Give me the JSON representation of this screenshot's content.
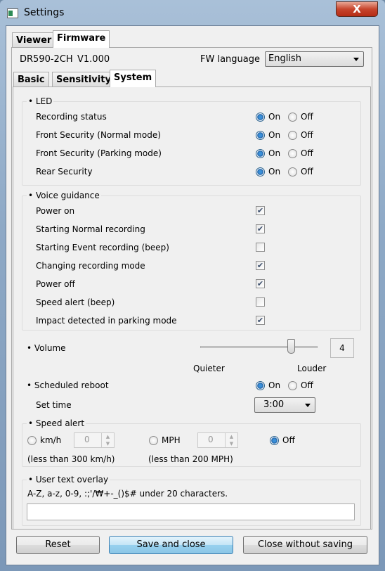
{
  "window": {
    "title": "Settings",
    "close": "X"
  },
  "tabs": [
    {
      "label": "Viewer"
    },
    {
      "label": "Firmware"
    }
  ],
  "model": "DR590-2CH",
  "version": "V1.000",
  "fw_language": {
    "label": "FW language",
    "value": "English"
  },
  "subtabs": [
    {
      "label": "Basic"
    },
    {
      "label": "Sensitivity"
    },
    {
      "label": "System"
    }
  ],
  "led": {
    "title": "• LED",
    "on": "On",
    "off": "Off",
    "items": [
      {
        "label": "Recording status",
        "value": "On"
      },
      {
        "label": "Front Security (Normal mode)",
        "value": "On"
      },
      {
        "label": "Front Security (Parking mode)",
        "value": "On"
      },
      {
        "label": "Rear Security",
        "value": "On"
      }
    ]
  },
  "voice": {
    "title": "• Voice guidance",
    "items": [
      {
        "label": "Power on",
        "checked": true
      },
      {
        "label": "Starting Normal recording",
        "checked": true
      },
      {
        "label": "Starting Event recording (beep)",
        "checked": false
      },
      {
        "label": "Changing recording mode",
        "checked": true
      },
      {
        "label": "Power off",
        "checked": true
      },
      {
        "label": "Speed alert (beep)",
        "checked": false
      },
      {
        "label": "Impact detected in parking mode",
        "checked": true
      }
    ]
  },
  "volume": {
    "label": "• Volume",
    "value": "4",
    "min": 0,
    "max": 5,
    "quieter": "Quieter",
    "louder": "Louder"
  },
  "reboot": {
    "label": "• Scheduled reboot",
    "on": "On",
    "off": "Off",
    "value": "On",
    "set_time_label": "Set time",
    "time": "3:00"
  },
  "speed": {
    "title": "• Speed alert",
    "kmh": "km/h",
    "kmh_value": "0",
    "kmh_note": "(less than 300 km/h)",
    "mph": "MPH",
    "mph_value": "0",
    "mph_note": "(less than 200 MPH)",
    "off": "Off",
    "selected": "Off"
  },
  "overlay": {
    "title": "• User text overlay",
    "hint": "A-Z, a-z, 0-9, :;'/₩+-_()$# under 20 characters.",
    "value": ""
  },
  "buttons": {
    "reset": "Reset",
    "save": "Save and close",
    "close": "Close without saving"
  }
}
